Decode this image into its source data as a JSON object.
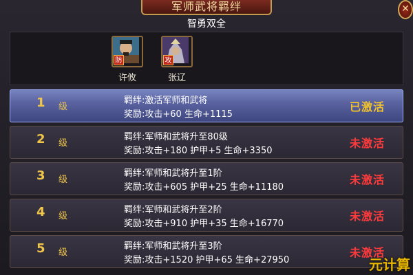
{
  "window": {
    "title": "军师武将羁绊"
  },
  "set": {
    "name": "智勇双全"
  },
  "heroes": [
    {
      "name": "许攸",
      "role": "防"
    },
    {
      "name": "张辽",
      "role": "攻"
    }
  ],
  "levels": [
    {
      "num": "1",
      "unit": "级",
      "condition": "羁绊:激活军师和武将",
      "reward": "奖励:攻击+60 生命+1115",
      "status": "已激活",
      "active": true
    },
    {
      "num": "2",
      "unit": "级",
      "condition": "羁绊:军师和武将升至80级",
      "reward": "奖励:攻击+180 护甲+5 生命+3350",
      "status": "未激活",
      "active": false
    },
    {
      "num": "3",
      "unit": "级",
      "condition": "羁绊:军师和武将升至1阶",
      "reward": "奖励:攻击+605 护甲+25 生命+11180",
      "status": "未激活",
      "active": false
    },
    {
      "num": "4",
      "unit": "级",
      "condition": "羁绊:军师和武将升至2阶",
      "reward": "奖励:攻击+910 护甲+35 生命+16770",
      "status": "未激活",
      "active": false
    },
    {
      "num": "5",
      "unit": "级",
      "condition": "羁绊:军师和武将升至3阶",
      "reward": "奖励:攻击+1520 护甲+65 生命+27950",
      "status": "未激活",
      "active": false
    }
  ],
  "close_icon": "close-icon",
  "watermark": "元计算"
}
